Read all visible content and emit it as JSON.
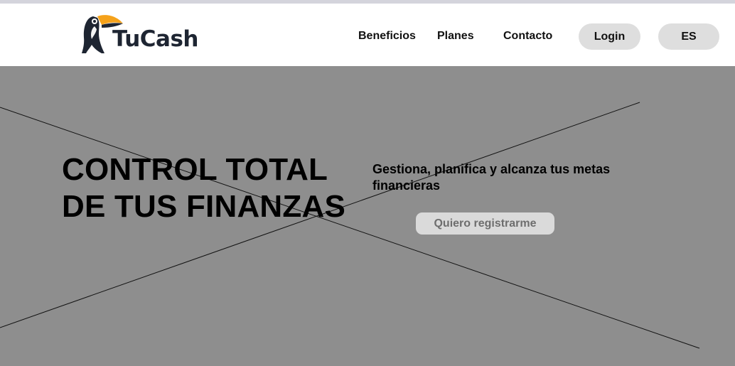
{
  "brand": {
    "name": "TuCash",
    "colors": {
      "text": "#1e2532",
      "beak": "#f5a21b",
      "eye_ring": "#f5a21b"
    }
  },
  "nav": {
    "items": [
      {
        "label": "Beneficios"
      },
      {
        "label": "Planes"
      },
      {
        "label": "Contacto"
      }
    ],
    "login_label": "Login",
    "language_label": "ES"
  },
  "hero": {
    "headline_line1": "CONTROL TOTAL",
    "headline_line2": "DE TUS FINANZAS",
    "subheadline": "Gestiona, planifica y alcanza tus metas financieras",
    "cta_label": "Quiero registrarme",
    "background_color": "#8e8e8e",
    "image_placeholder": "image-placeholder-x"
  }
}
